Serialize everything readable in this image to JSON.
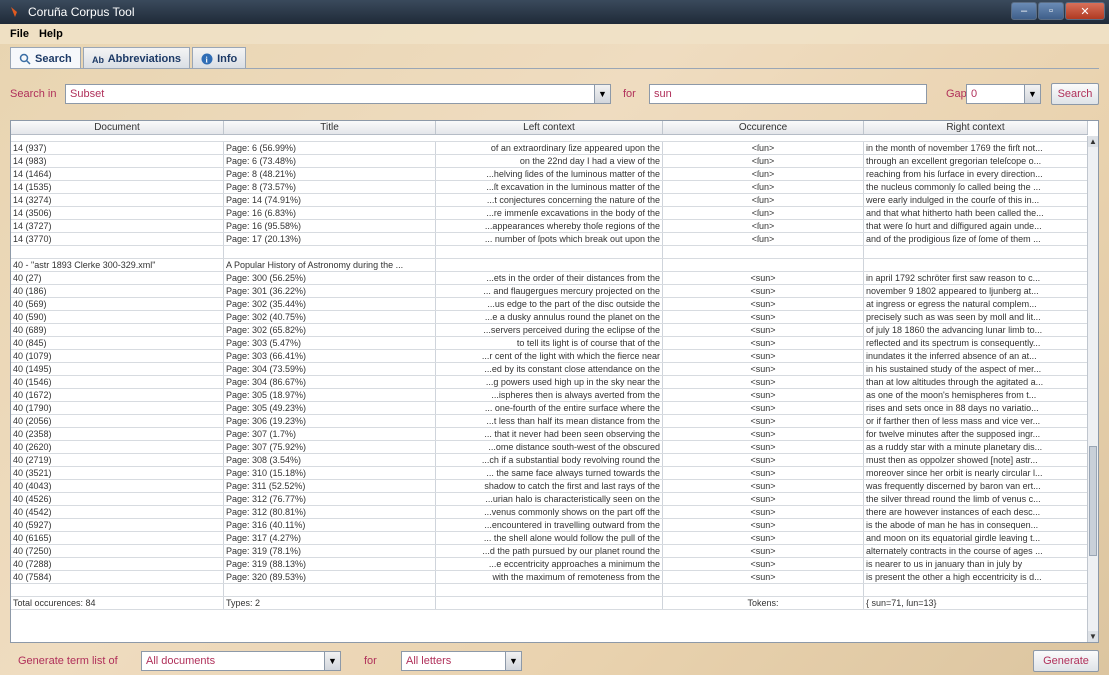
{
  "window": {
    "title": "Coruña Corpus Tool",
    "controls": [
      "–",
      "▫",
      "✕"
    ]
  },
  "menu": {
    "file": "File",
    "help": "Help"
  },
  "tabs": [
    {
      "label": "Search",
      "icon": "search-icon"
    },
    {
      "label": "Abbreviations",
      "icon": "abbreviations-icon"
    },
    {
      "label": "Info",
      "icon": "info-icon"
    }
  ],
  "search": {
    "search_in_label": "Search in",
    "search_in_value": "Subset",
    "for_label": "for",
    "for_value": "sun",
    "gap_label": "Gap",
    "gap_value": "0",
    "button": "Search"
  },
  "table": {
    "columns": [
      "Document",
      "Title",
      "Left context",
      "Occurence",
      "Right context"
    ],
    "rows": [
      [
        "14 (937)",
        "Page: 6 (56.99%)",
        "of an extraordinary ſize appeared upon the",
        "<ſun>",
        "in the month of november 1769 the firſt not..."
      ],
      [
        "14 (983)",
        "Page: 6 (73.48%)",
        "on the 22nd day I had a view of the",
        "<ſun>",
        "through an excellent gregorian teleſcope o..."
      ],
      [
        "14 (1464)",
        "Page: 8 (48.21%)",
        "...helving ſides of the luminous matter of the",
        "<ſun>",
        "reaching from his ſurface in every direction..."
      ],
      [
        "14 (1535)",
        "Page: 8 (73.57%)",
        "...ſt excavation in the luminous matter of the",
        "<ſun>",
        "the nucleus commonly ſo called being the ..."
      ],
      [
        "14 (3274)",
        "Page: 14 (74.91%)",
        "...t conjectures concerning the nature of the",
        "<ſun>",
        "were early indulged in the courſe of this in..."
      ],
      [
        "14 (3506)",
        "Page: 16 (6.83%)",
        "...re immenſe excavations in the body of the",
        "<ſun>",
        "and that what hitherto hath been called the..."
      ],
      [
        "14 (3727)",
        "Page: 16 (95.58%)",
        "...appearances whereby thoſe regions of the",
        "<ſun>",
        "that were ſo hurt and diſfigured again unde..."
      ],
      [
        "14 (3770)",
        "Page: 17 (20.13%)",
        "... number of ſpots which break out upon the",
        "<ſun>",
        "and of the prodigious ſize of ſome of them ..."
      ],
      [
        "",
        "",
        "",
        "",
        ""
      ],
      [
        "40 - \"astr 1893 Clerke 300-329.xml\"",
        "A Popular History of Astronomy during the ...",
        "",
        "",
        ""
      ],
      [
        "40 (27)",
        "Page: 300 (56.25%)",
        "...ets in the order of their distances from the",
        "<sun>",
        "in april 1792 schröter first saw reason to c..."
      ],
      [
        "40 (186)",
        "Page: 301 (36.22%)",
        "... and flaugergues mercury projected on the",
        "<sun>",
        "november 9 1802 appeared to ljunberg at..."
      ],
      [
        "40 (569)",
        "Page: 302 (35.44%)",
        "...us edge to the part of the disc outside the",
        "<sun>",
        "at ingress or egress the natural complem..."
      ],
      [
        "40 (590)",
        "Page: 302 (40.75%)",
        "...e a dusky annulus round the planet on the",
        "<sun>",
        "precisely such as was seen by moll and lit..."
      ],
      [
        "40 (689)",
        "Page: 302 (65.82%)",
        "...servers perceived during the eclipse of the",
        "<sun>",
        "of july 18 1860 the advancing lunar limb to..."
      ],
      [
        "40 (845)",
        "Page: 303 (5.47%)",
        "to tell its light is of course that of the",
        "<sun>",
        "reflected and its spectrum is consequently..."
      ],
      [
        "40 (1079)",
        "Page: 303 (66.41%)",
        "...r cent of the light with which the fierce near",
        "<sun>",
        "inundates it the inferred absence of an at..."
      ],
      [
        "40 (1495)",
        "Page: 304 (73.59%)",
        "...ed by its constant close attendance on the",
        "<sun>",
        "in his sustained study of the aspect of mer..."
      ],
      [
        "40 (1546)",
        "Page: 304 (86.67%)",
        "...g powers used high up in the sky near the",
        "<sun>",
        "than at low altitudes through the agitated a..."
      ],
      [
        "40 (1672)",
        "Page: 305 (18.97%)",
        "...ispheres then is always averted from the",
        "<sun>",
        "as one of the moon's hemispheres from t..."
      ],
      [
        "40 (1790)",
        "Page: 305 (49.23%)",
        "... one-fourth of the entire surface where the",
        "<sun>",
        "rises and sets once in 88 days no variatio..."
      ],
      [
        "40 (2056)",
        "Page: 306 (19.23%)",
        "...t less than half its mean distance from the",
        "<sun>",
        "or if farther then of less mass and vice ver..."
      ],
      [
        "40 (2358)",
        "Page: 307 (1.7%)",
        "... that it never had been seen observing the",
        "<sun>",
        "for twelve minutes after the supposed ingr..."
      ],
      [
        "40 (2620)",
        "Page: 307 (75.92%)",
        "...ome distance south-west of the obscured",
        "<sun>",
        "as a ruddy star with a minute planetary dis..."
      ],
      [
        "40 (2719)",
        "Page: 308 (3.54%)",
        "...ch if a substantial body revolving round the",
        "<sun>",
        "must then as oppolzer showed [note] astr..."
      ],
      [
        "40 (3521)",
        "Page: 310 (15.18%)",
        "... the same face always turned towards the",
        "<sun>",
        "moreover since her orbit is nearly circular l..."
      ],
      [
        "40 (4043)",
        "Page: 311 (52.52%)",
        "shadow to catch the first and last rays of the",
        "<sun>",
        "was frequently discerned by baron van ert..."
      ],
      [
        "40 (4526)",
        "Page: 312 (76.77%)",
        "...urian halo is characteristically seen on the",
        "<sun>",
        "the silver thread round the limb of venus c..."
      ],
      [
        "40 (4542)",
        "Page: 312 (80.81%)",
        "...venus commonly shows on the part off the",
        "<sun>",
        "there are however instances of each desc..."
      ],
      [
        "40 (5927)",
        "Page: 316 (40.11%)",
        "...encountered in travelling outward from the",
        "<sun>",
        "is the abode of man he has in consequen..."
      ],
      [
        "40 (6165)",
        "Page: 317 (4.27%)",
        "... the shell alone would follow the pull of the",
        "<sun>",
        "and moon on its equatorial girdle leaving t..."
      ],
      [
        "40 (7250)",
        "Page: 319 (78.1%)",
        "...d the path pursued by our planet round the",
        "<sun>",
        "alternately contracts in the course of ages ..."
      ],
      [
        "40 (7288)",
        "Page: 319 (88.13%)",
        "...e eccentricity approaches a minimum the",
        "<sun>",
        "is nearer to us in january than in july by"
      ],
      [
        "40 (7584)",
        "Page: 320 (89.53%)",
        "with the maximum of remoteness from the",
        "<sun>",
        "is present the other a high eccentricity is d..."
      ],
      [
        "",
        "",
        "",
        "",
        ""
      ]
    ],
    "summary": [
      "Total occurences: 84",
      "Types: 2",
      "",
      "Tokens:",
      "{ sun=71, ſun=13}"
    ]
  },
  "termlist": {
    "label": "Generate term list of",
    "documents_value": "All documents",
    "for_label": "for",
    "letters_value": "All letters",
    "button": "Generate"
  },
  "colors": {
    "accent_text": "#b0305a",
    "titlebar": "#1f2a38"
  }
}
